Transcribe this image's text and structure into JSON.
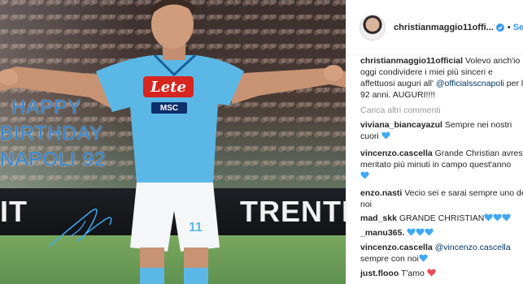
{
  "photo": {
    "greeting_lines": [
      "HAPPY",
      "BIRTHDAY",
      "NAPOLI 92"
    ],
    "sponsor": "Lete",
    "kit_sponsor": "MSC",
    "billboard_left": "IT",
    "billboard_right": "TRENTI",
    "shirt_number": "11"
  },
  "header": {
    "username": "christianmaggio11offi...",
    "follow_label": "Seg",
    "separator": "•"
  },
  "caption": {
    "author": "christianmaggio11official",
    "line1": " Volevo anch'io",
    "line2": "oggi condividere i miei più sinceri e",
    "line3": "affettuosi auguri all' ",
    "mention": "@officialsscnapoli",
    "line3_end": " per le",
    "line4": "92 anni. AUGURI!!!!"
  },
  "load_more_label": "Carica altri commenti",
  "comments": [
    {
      "user": "viviana_biancayazul",
      "lines": [
        " Sempre nei nostri",
        "cuori "
      ],
      "hearts": 1,
      "heart_color": "blue"
    },
    {
      "user": "vincenzo.cascella",
      "lines": [
        " Grande Christian avresti",
        "meritato più minuti in campo quest'anno",
        ""
      ],
      "hearts": 1,
      "heart_color": "blue"
    },
    {
      "user": "enzo.nasti",
      "lines": [
        " Vecio sei e sarai sempre uno dei",
        "noi"
      ],
      "hearts": 0,
      "heart_color": "blue"
    },
    {
      "user": "mad_skk",
      "lines": [
        " GRANDE CHRISTIAN"
      ],
      "hearts": 3,
      "heart_color": "blue"
    },
    {
      "user": "_manu365.",
      "lines": [
        " "
      ],
      "hearts": 3,
      "heart_color": "blue"
    },
    {
      "user": "vincenzo.cascella",
      "lines": [
        " @vincenzo.cascella",
        "sempre con noi"
      ],
      "hearts": 1,
      "heart_color": "blue"
    },
    {
      "user": "just.flooo",
      "lines": [
        " T'amo "
      ],
      "hearts": 1,
      "heart_color": "red"
    }
  ],
  "colors": {
    "accent_blue": "#3897f0",
    "napoli_blue": "#5bb8e6",
    "greeting_blue": "#2f86d6",
    "heart_blue": "#3fa9f5",
    "heart_red": "#ed4956"
  }
}
